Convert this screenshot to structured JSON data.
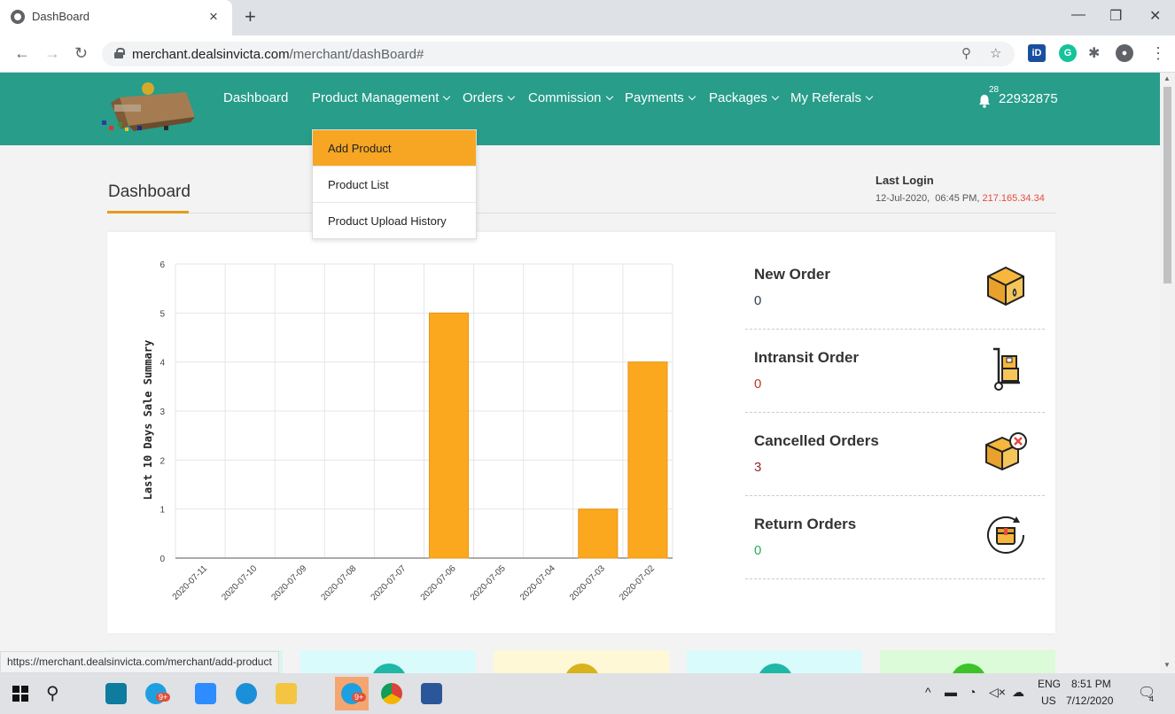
{
  "browser": {
    "tab_title": "DashBoard",
    "tab_close": "×",
    "new_tab": "+",
    "url_host": "merchant.dealsinvicta.com",
    "url_path": "/merchant/dashBoard#",
    "status_url": "https://merchant.dealsinvicta.com/merchant/add-product"
  },
  "nav": {
    "dashboard": "Dashboard",
    "product_management": "Product Management",
    "orders": "Orders",
    "commission": "Commission",
    "payments": "Payments",
    "packages": "Packages",
    "my_referals": "My Referals",
    "notification_count": "28",
    "user_id": "22932875"
  },
  "dropdown": {
    "items": [
      "Add Product",
      "Product List",
      "Product Upload History"
    ]
  },
  "page": {
    "title": "Dashboard",
    "last_login_label": "Last Login",
    "last_login_date": "12-Jul-2020,",
    "last_login_time": "06:45 PM,",
    "last_login_ip": "217.165.34.34"
  },
  "stats": [
    {
      "label": "New Order",
      "value": "0",
      "color": "#2c3e50",
      "icon": "box-icon"
    },
    {
      "label": "Intransit Order",
      "value": "0",
      "color": "#c0392b",
      "icon": "trolley-icon"
    },
    {
      "label": "Cancelled Orders",
      "value": "3",
      "color": "#8e2a2a",
      "icon": "cancelled-box-icon"
    },
    {
      "label": "Return Orders",
      "value": "0",
      "color": "#27ae60",
      "icon": "return-box-icon"
    }
  ],
  "chart_data": {
    "type": "bar",
    "categories": [
      "2020-07-11",
      "2020-07-10",
      "2020-07-09",
      "2020-07-08",
      "2020-07-07",
      "2020-07-06",
      "2020-07-05",
      "2020-07-04",
      "2020-07-03",
      "2020-07-02"
    ],
    "values": [
      0,
      0,
      0,
      0,
      0,
      5,
      0,
      0,
      1,
      4
    ],
    "ylabel": "Last 10 Days Sale Summary",
    "xlabel": "",
    "ylim": [
      0,
      6
    ],
    "yticks": [
      0,
      1,
      2,
      3,
      4,
      5,
      6
    ],
    "grid": true,
    "bar_color": "#fba81e"
  },
  "mini_cards": [
    {
      "bg": "#dbf5ec",
      "circle": ""
    },
    {
      "bg": "#d9fbfb",
      "circle": "#1fb7a5"
    },
    {
      "bg": "#fef8d6",
      "circle": "#d9b31c"
    },
    {
      "bg": "#d9fbfb",
      "circle": "#1fb7a5"
    },
    {
      "bg": "#dcfbd8",
      "circle": "#3dc22a"
    }
  ],
  "taskbar": {
    "lang": "ENG",
    "region": "US",
    "time": "8:51 PM",
    "date": "7/12/2020",
    "notif_count": "4",
    "badge": "9+"
  }
}
